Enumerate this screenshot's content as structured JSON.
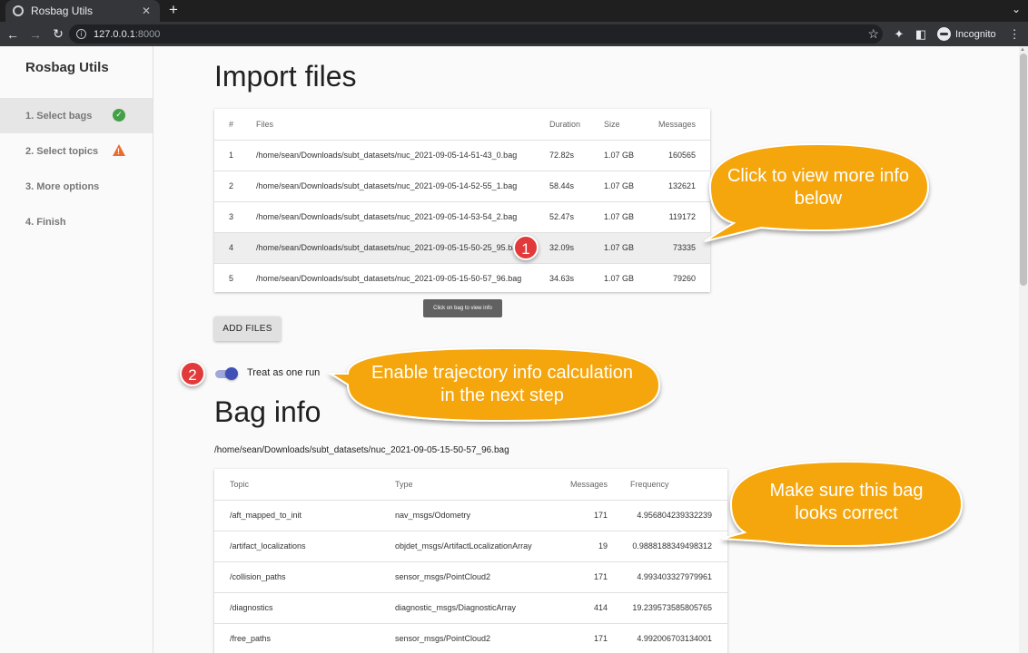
{
  "browser": {
    "tab_title": "Rosbag Utils",
    "tab_close": "✕",
    "new_tab": "+",
    "url_host": "127.0.0.1",
    "url_port": ":8000",
    "profile_label": "Incognito"
  },
  "sidebar": {
    "title": "Rosbag Utils",
    "steps": [
      {
        "label": "1. Select bags",
        "status": "complete"
      },
      {
        "label": "2. Select topics",
        "status": "warning"
      },
      {
        "label": "3. More options",
        "status": ""
      },
      {
        "label": "4. Finish",
        "status": ""
      }
    ]
  },
  "import": {
    "heading": "Import files",
    "columns": [
      "#",
      "Files",
      "Duration",
      "Size",
      "Messages"
    ],
    "rows": [
      {
        "num": "1",
        "file": "/home/sean/Downloads/subt_datasets/nuc_2021-09-05-14-51-43_0.bag",
        "duration": "72.82s",
        "size": "1.07 GB",
        "messages": "160565"
      },
      {
        "num": "2",
        "file": "/home/sean/Downloads/subt_datasets/nuc_2021-09-05-14-52-55_1.bag",
        "duration": "58.44s",
        "size": "1.07 GB",
        "messages": "132621"
      },
      {
        "num": "3",
        "file": "/home/sean/Downloads/subt_datasets/nuc_2021-09-05-14-53-54_2.bag",
        "duration": "52.47s",
        "size": "1.07 GB",
        "messages": "119172"
      },
      {
        "num": "4",
        "file": "/home/sean/Downloads/subt_datasets/nuc_2021-09-05-15-50-25_95.bag",
        "duration": "32.09s",
        "size": "1.07 GB",
        "messages": "73335"
      },
      {
        "num": "5",
        "file": "/home/sean/Downloads/subt_datasets/nuc_2021-09-05-15-50-57_96.bag",
        "duration": "34.63s",
        "size": "1.07 GB",
        "messages": "79260"
      }
    ],
    "tooltip": "Click on bag to view info",
    "add_button": "ADD FILES",
    "toggle_label": "Treat as one run"
  },
  "baginfo": {
    "heading": "Bag info",
    "path": "/home/sean/Downloads/subt_datasets/nuc_2021-09-05-15-50-57_96.bag",
    "columns": [
      "Topic",
      "Type",
      "Messages",
      "Frequency"
    ],
    "rows": [
      {
        "topic": "/aft_mapped_to_init",
        "type": "nav_msgs/Odometry",
        "messages": "171",
        "frequency": "4.956804239332239"
      },
      {
        "topic": "/artifact_localizations",
        "type": "objdet_msgs/ArtifactLocalizationArray",
        "messages": "19",
        "frequency": "0.9888188349498312"
      },
      {
        "topic": "/collision_paths",
        "type": "sensor_msgs/PointCloud2",
        "messages": "171",
        "frequency": "4.993403327979961"
      },
      {
        "topic": "/diagnostics",
        "type": "diagnostic_msgs/DiagnosticArray",
        "messages": "414",
        "frequency": "19.239573585805765"
      },
      {
        "topic": "/free_paths",
        "type": "sensor_msgs/PointCloud2",
        "messages": "171",
        "frequency": "4.992006703134001"
      }
    ]
  },
  "annotations": {
    "badge1": "1",
    "badge2": "2",
    "callout1": "Click to view more info below",
    "callout2": "Enable trajectory info calculation in the next step",
    "callout3": "Make sure this bag looks correct",
    "callout_color": "#f5a60b",
    "badge_color": "#e23a3a"
  },
  "colors": {
    "toggle_accent": "#3f51b5",
    "check": "#43a047",
    "warning": "#ec6c2d"
  }
}
